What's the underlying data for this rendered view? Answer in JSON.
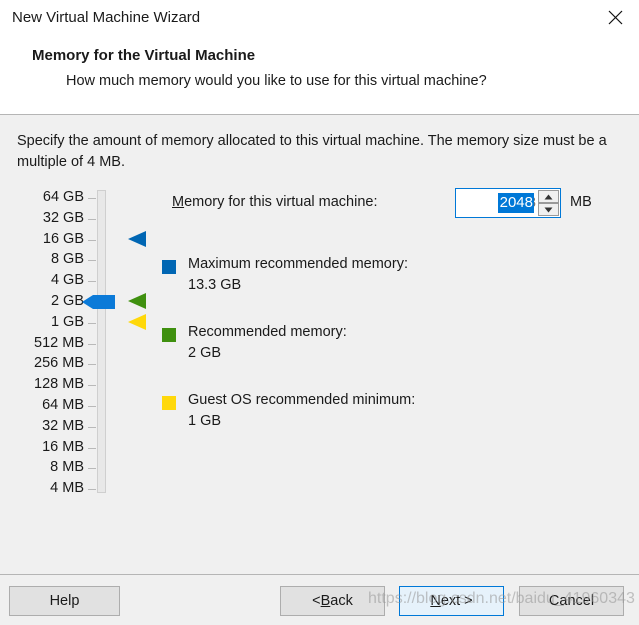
{
  "window": {
    "title": "New Virtual Machine Wizard",
    "close_icon": "close-icon"
  },
  "header": {
    "title": "Memory for the Virtual Machine",
    "subtitle": "How much memory would you like to use for this virtual machine?"
  },
  "body": {
    "instructions": "Specify the amount of memory allocated to this virtual machine. The memory size must be a multiple of 4 MB."
  },
  "scale": {
    "labels": [
      "64 GB",
      "32 GB",
      "16 GB",
      "8 GB",
      "4 GB",
      "2 GB",
      "1 GB",
      "512 MB",
      "256 MB",
      "128 MB",
      "64 MB",
      "32 MB",
      "16 MB",
      "8 MB",
      "4 MB"
    ],
    "slider_value_label": "2 GB",
    "slider_index": 5,
    "markers": [
      {
        "name": "maximum-recommended-marker",
        "color": "#0066b3",
        "index": 2
      },
      {
        "name": "recommended-marker",
        "color": "#3f900f",
        "index": 5
      },
      {
        "name": "guest-os-minimum-marker",
        "color": "#ffd80a",
        "index": 6
      }
    ]
  },
  "memory_field": {
    "label_prefix": "",
    "label_accel": "M",
    "label_rest": "emory for this virtual machine:",
    "value": "2048",
    "placeholder": "2048",
    "unit": "MB",
    "spin_up_icon": "chevron-up-icon",
    "spin_down_icon": "chevron-down-icon"
  },
  "legend": [
    {
      "name": "maximum-recommended-memory",
      "color": "#0066b3",
      "title": "Maximum recommended memory:",
      "value": "13.3 GB"
    },
    {
      "name": "recommended-memory",
      "color": "#3f900f",
      "title": "Recommended memory:",
      "value": "2 GB"
    },
    {
      "name": "guest-os-recommended-minimum",
      "color": "#ffd80a",
      "title": "Guest OS recommended minimum:",
      "value": "1 GB"
    }
  ],
  "footer": {
    "help_label": "Help",
    "back_prefix": "< ",
    "back_accel": "B",
    "back_rest": "ack",
    "next_accel": "N",
    "next_rest": "ext >",
    "cancel_label": "Cancel"
  },
  "watermark": {
    "text": "https://blog.csdn.net/baidu_41960343"
  },
  "colors": {
    "accent": "#0078d7",
    "max_memory": "#0066b3",
    "recommended": "#3f900f",
    "guest_minimum": "#ffd80a",
    "window_bg": "#f0f0f0"
  }
}
